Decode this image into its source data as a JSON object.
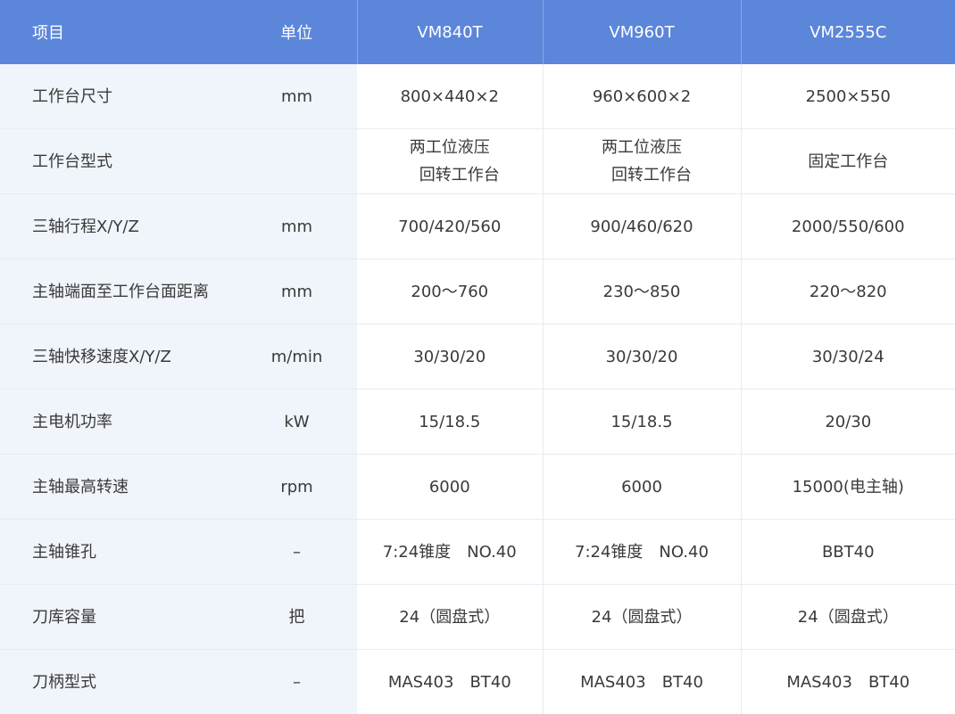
{
  "header": {
    "item": "项目",
    "unit": "单位",
    "models": [
      "VM840T",
      "VM960T",
      "VM2555C"
    ]
  },
  "rows": [
    {
      "name": "工作台尺寸",
      "unit": "mm",
      "values": [
        "800×440×2",
        "960×600×2",
        "2500×550"
      ]
    },
    {
      "name": "工作台型式",
      "unit": "",
      "values": [
        [
          "两工位液压",
          "回转工作台"
        ],
        [
          "两工位液压",
          "回转工作台"
        ],
        "固定工作台"
      ]
    },
    {
      "name": "三轴行程X/Y/Z",
      "unit": "mm",
      "values": [
        "700/420/560",
        "900/460/620",
        "2000/550/600"
      ]
    },
    {
      "name": "主轴端面至工作台面距离",
      "unit": "mm",
      "values": [
        "200～760",
        "230～850",
        "220～820"
      ]
    },
    {
      "name": "三轴快移速度X/Y/Z",
      "unit": "m/min",
      "values": [
        "30/30/20",
        "30/30/20",
        "30/30/24"
      ]
    },
    {
      "name": "主电机功率",
      "unit": "kW",
      "values": [
        "15/18.5",
        "15/18.5",
        "20/30"
      ]
    },
    {
      "name": "主轴最高转速",
      "unit": "rpm",
      "values": [
        "6000",
        "6000",
        "15000(电主轴)"
      ]
    },
    {
      "name": "主轴锥孔",
      "unit": "–",
      "values": [
        "7:24锥度　NO.40",
        "7:24锥度　NO.40",
        "BBT40"
      ]
    },
    {
      "name": "刀库容量",
      "unit": "把",
      "values": [
        "24（圆盘式）",
        "24（圆盘式）",
        "24（圆盘式）"
      ]
    },
    {
      "name": "刀柄型式",
      "unit": "–",
      "values": [
        "MAS403　BT40",
        "MAS403　BT40",
        "MAS403　BT40"
      ]
    }
  ]
}
